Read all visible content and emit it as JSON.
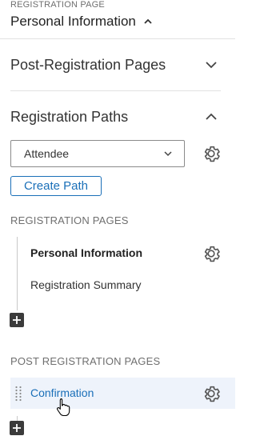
{
  "header": {
    "overline": "REGISTRATION PAGE",
    "title": "Personal Information"
  },
  "sections": {
    "post_registration_pages": "Post-Registration Pages",
    "registration_paths": "Registration Paths"
  },
  "path_select": {
    "selected": "Attendee"
  },
  "create_path_label": "Create Path",
  "registration_pages": {
    "heading": "REGISTRATION PAGES",
    "items": [
      {
        "label": "Personal Information"
      },
      {
        "label": "Registration Summary"
      }
    ]
  },
  "post_registration": {
    "heading": "POST REGISTRATION PAGES",
    "items": [
      {
        "label": "Confirmation"
      }
    ]
  },
  "colors": {
    "accent": "#1a6fb8",
    "highlight": "#eef3fb",
    "divider": "#e1e1e1"
  },
  "icons": [
    "chevron-up-icon",
    "chevron-down-icon",
    "gear-icon",
    "plus-icon",
    "drag-handle-icon",
    "hand-cursor-icon"
  ]
}
